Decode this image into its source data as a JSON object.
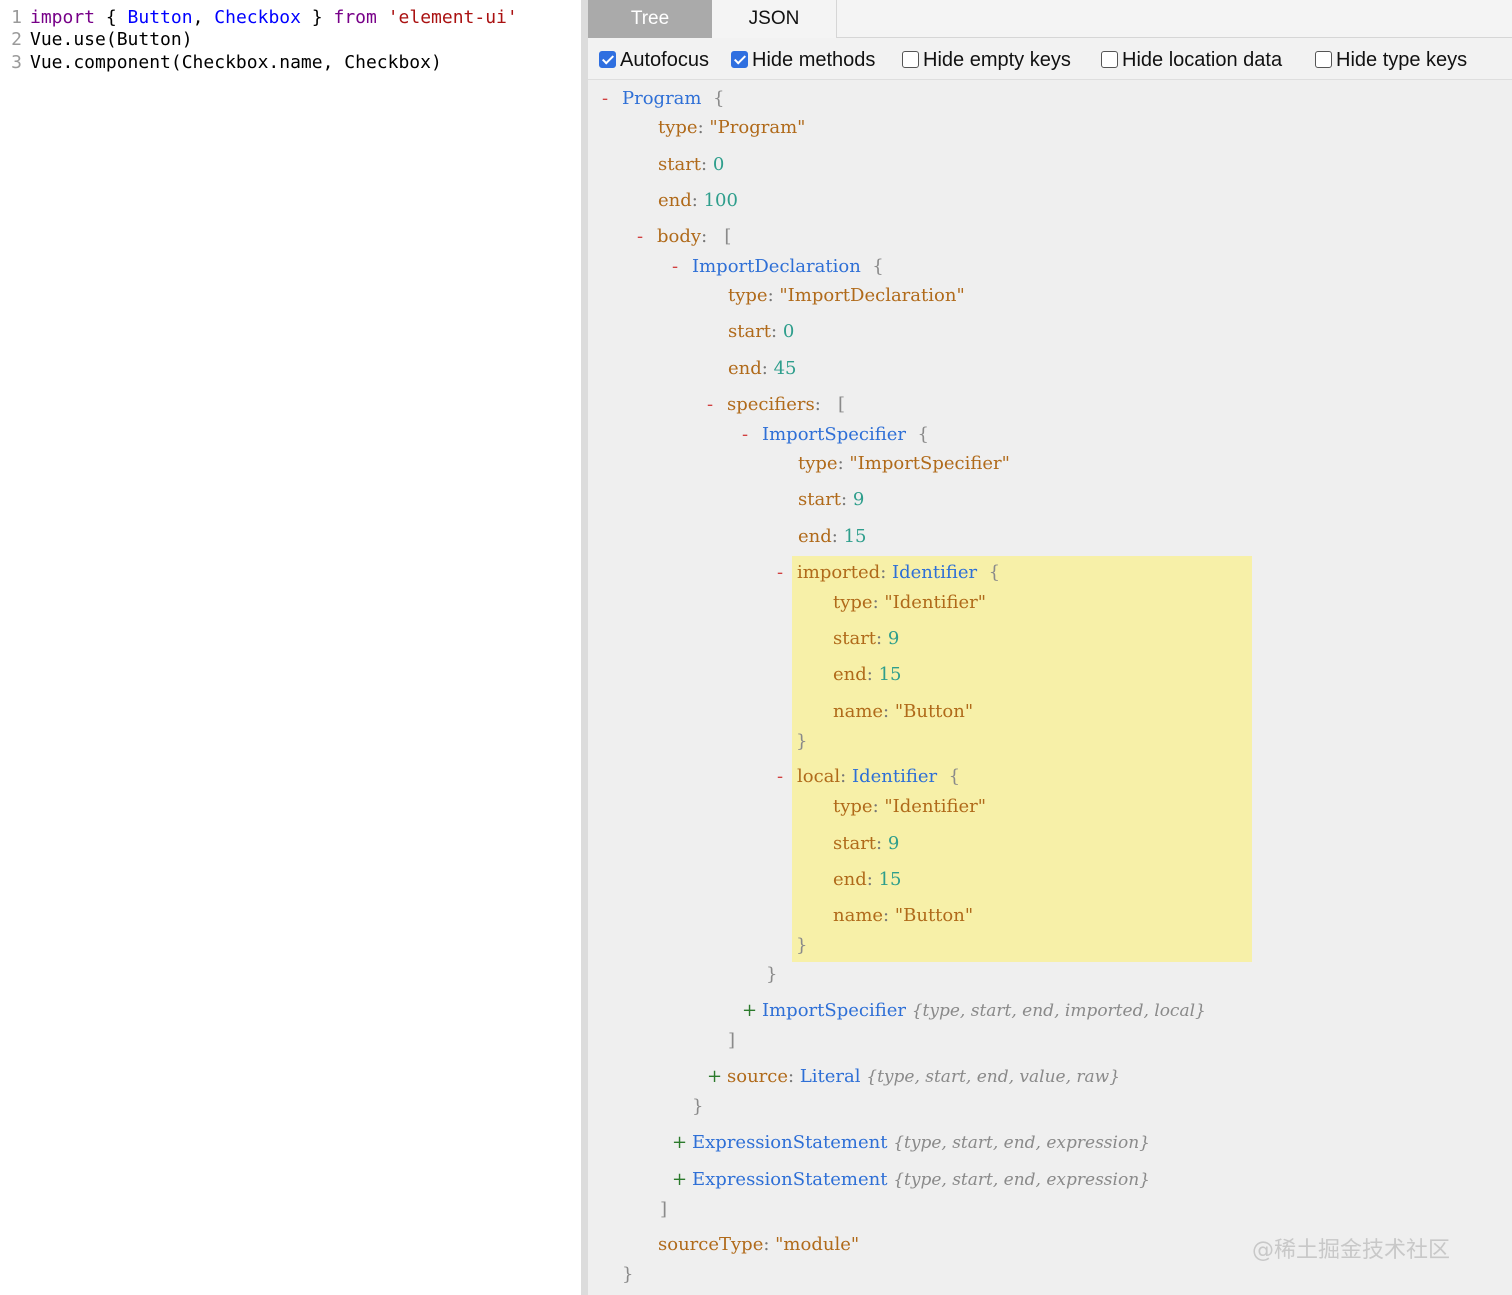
{
  "editor": {
    "lines": [
      {
        "num": "1",
        "segments": [
          {
            "t": "import",
            "c": "kw"
          },
          {
            "t": " { ",
            "c": "plain"
          },
          {
            "t": "Button",
            "c": "def"
          },
          {
            "t": ", ",
            "c": "plain"
          },
          {
            "t": "Checkbox",
            "c": "def"
          },
          {
            "t": " } ",
            "c": "plain"
          },
          {
            "t": "from",
            "c": "kw"
          },
          {
            "t": " ",
            "c": "plain"
          },
          {
            "t": "'element-ui'",
            "c": "str"
          }
        ]
      },
      {
        "num": "2",
        "segments": [
          {
            "t": "Vue.use(Button)",
            "c": "plain"
          }
        ]
      },
      {
        "num": "3",
        "segments": [
          {
            "t": "Vue.component(Checkbox.name, Checkbox)",
            "c": "plain"
          }
        ]
      }
    ]
  },
  "tabs": {
    "tree": "Tree",
    "json": "JSON",
    "active": "Tree"
  },
  "options": [
    {
      "label": "Autofocus",
      "checked": true
    },
    {
      "label": "Hide methods",
      "checked": true
    },
    {
      "label": "Hide empty keys",
      "checked": false
    },
    {
      "label": "Hide location data",
      "checked": false
    },
    {
      "label": "Hide type keys",
      "checked": false
    }
  ],
  "tree": [
    {
      "toggle": "-",
      "node": "Program",
      "open": "{"
    },
    {
      "key": "type",
      "str": "\"Program\""
    },
    {
      "key": "start",
      "num": "0"
    },
    {
      "key": "end",
      "num": "100"
    },
    {
      "toggle": "-",
      "key": "body",
      "open": "["
    },
    {
      "toggle": "-",
      "node": "ImportDeclaration",
      "open": "{"
    },
    {
      "key": "type",
      "str": "\"ImportDeclaration\""
    },
    {
      "key": "start",
      "num": "0"
    },
    {
      "key": "end",
      "num": "45"
    },
    {
      "toggle": "-",
      "key": "specifiers",
      "open": "["
    },
    {
      "toggle": "-",
      "node": "ImportSpecifier",
      "open": "{"
    },
    {
      "key": "type",
      "str": "\"ImportSpecifier\""
    },
    {
      "key": "start",
      "num": "9"
    },
    {
      "key": "end",
      "num": "15"
    },
    {
      "toggle": "-",
      "key": "imported",
      "node": "Identifier",
      "open": "{"
    },
    {
      "key": "type",
      "str": "\"Identifier\""
    },
    {
      "key": "start",
      "num": "9"
    },
    {
      "key": "end",
      "num": "15"
    },
    {
      "key": "name",
      "str": "\"Button\""
    },
    {
      "close": "}"
    },
    {
      "toggle": "-",
      "key": "local",
      "node": "Identifier",
      "open": "{"
    },
    {
      "key": "type",
      "str": "\"Identifier\""
    },
    {
      "key": "start",
      "num": "9"
    },
    {
      "key": "end",
      "num": "15"
    },
    {
      "key": "name",
      "str": "\"Button\""
    },
    {
      "close": "}"
    },
    {
      "close": "}"
    },
    {
      "toggle": "+",
      "node": "ImportSpecifier",
      "summary": "{type, start, end, imported, local}"
    },
    {
      "close": "]"
    },
    {
      "toggle": "+",
      "key": "source",
      "node": "Literal",
      "summary": "{type, start, end, value, raw}"
    },
    {
      "close": "}"
    },
    {
      "toggle": "+",
      "node": "ExpressionStatement",
      "summary": "{type, start, end, expression}"
    },
    {
      "toggle": "+",
      "node": "ExpressionStatement",
      "summary": "{type, start, end, expression}"
    },
    {
      "close": "]"
    },
    {
      "key": "sourceType",
      "str": "\"module\""
    },
    {
      "close": "}"
    }
  ],
  "watermark": "@稀土掘金技术社区"
}
